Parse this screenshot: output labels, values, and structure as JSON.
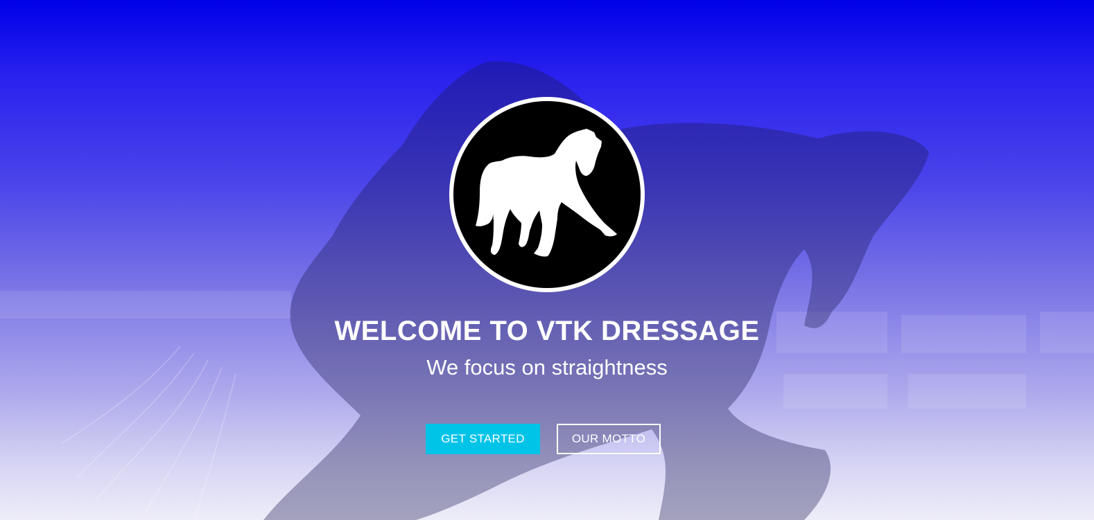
{
  "hero": {
    "title": "WELCOME TO VTK DRESSAGE",
    "subtitle": "We focus on straightness",
    "logo_icon": "horse-icon",
    "colors": {
      "background_top": "#0000e8",
      "background_bottom": "#eeedf8",
      "primary_button": "#00c3e8",
      "text": "#ffffff"
    }
  },
  "buttons": {
    "get_started": "GET STARTED",
    "our_motto": "OUR MOTTO"
  }
}
